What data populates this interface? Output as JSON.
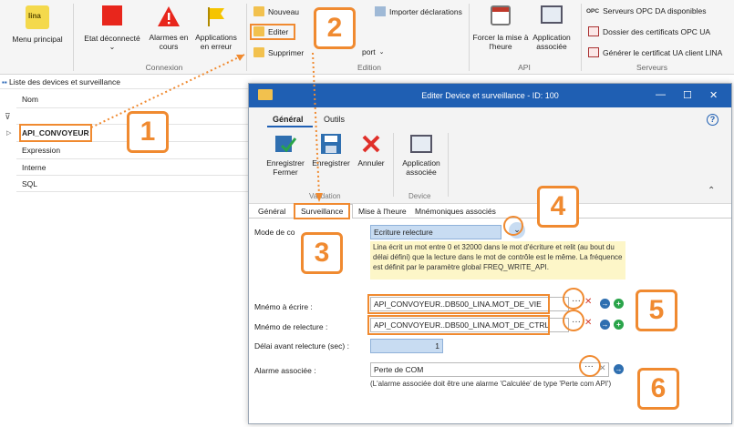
{
  "ribbon": {
    "groups": {
      "connexion": "Connexion",
      "edition": "Edition",
      "api": "API",
      "serveurs": "Serveurs"
    },
    "menu_principal": "Menu principal",
    "etat_deconnecte": "Etat déconnecté",
    "alarmes_en_cours": "Alarmes en cours",
    "applications_en_erreur": "Applications en erreur",
    "nouveau": "Nouveau",
    "editer": "Editer",
    "supprimer": "Supprimer",
    "importer_declarations": "Importer déclarations",
    "export_partial": "port",
    "forcer_mise_a_heure": "Forcer la mise à l'heure",
    "application_associee": "Application associée",
    "serveurs_opc": "Serveurs OPC DA disponibles",
    "dossier_certificats": "Dossier des certificats OPC UA",
    "generer_certificat": "Générer le certificat UA client LINA",
    "opc_badge": "OPC"
  },
  "left_panel": {
    "title": "Liste des devices et surveillance",
    "column_nom": "Nom",
    "rows": [
      "API_CONVOYEUR",
      "Expression",
      "Interne",
      "SQL"
    ]
  },
  "dialog": {
    "title": "Editer Device et surveillance - ID: 100",
    "tabs": [
      "Général",
      "Outils"
    ],
    "buttons": {
      "enregistrer_fermer": "Enregistrer Fermer",
      "enregistrer": "Enregistrer",
      "annuler": "Annuler",
      "application_associee": "Application associée"
    },
    "groups": {
      "validation": "Validation",
      "device": "Device"
    },
    "subtabs": [
      "Général",
      "Surveillance",
      "Mise à l'heure",
      "Mnémoniques associés"
    ],
    "mode_label": "Mode de co",
    "mode_value": "Ecriture relecture",
    "description": "Lina écrit un mot entre 0 et 32000 dans le mot d'écriture et relit (au bout du délai défini) que la lecture dans le mot de contrôle est le même. La fréquence est définit par le paramètre global FREQ_WRITE_API.",
    "mnemo_ecrire_label": "Mnémo à écrire :",
    "mnemo_ecrire_value": "API_CONVOYEUR..DB500_LINA.MOT_DE_VIE",
    "mnemo_relecture_label": "Mnémo de relecture :",
    "mnemo_relecture_value": "API_CONVOYEUR..DB500_LINA.MOT_DE_CTRL",
    "delai_label": "Délai avant relecture (sec) :",
    "delai_value": "1",
    "alarme_label": "Alarme associée :",
    "alarme_value": "Perte de COM",
    "alarme_note": "(L'alarme associée doit être une alarme 'Calculée' de type 'Perte com API')",
    "help": "?"
  },
  "callouts": [
    "1",
    "2",
    "3",
    "4",
    "5",
    "6"
  ],
  "colors": {
    "accent": "#f08a30",
    "titlebar": "#1f5fb3",
    "note_bg": "#fdf6c8"
  }
}
